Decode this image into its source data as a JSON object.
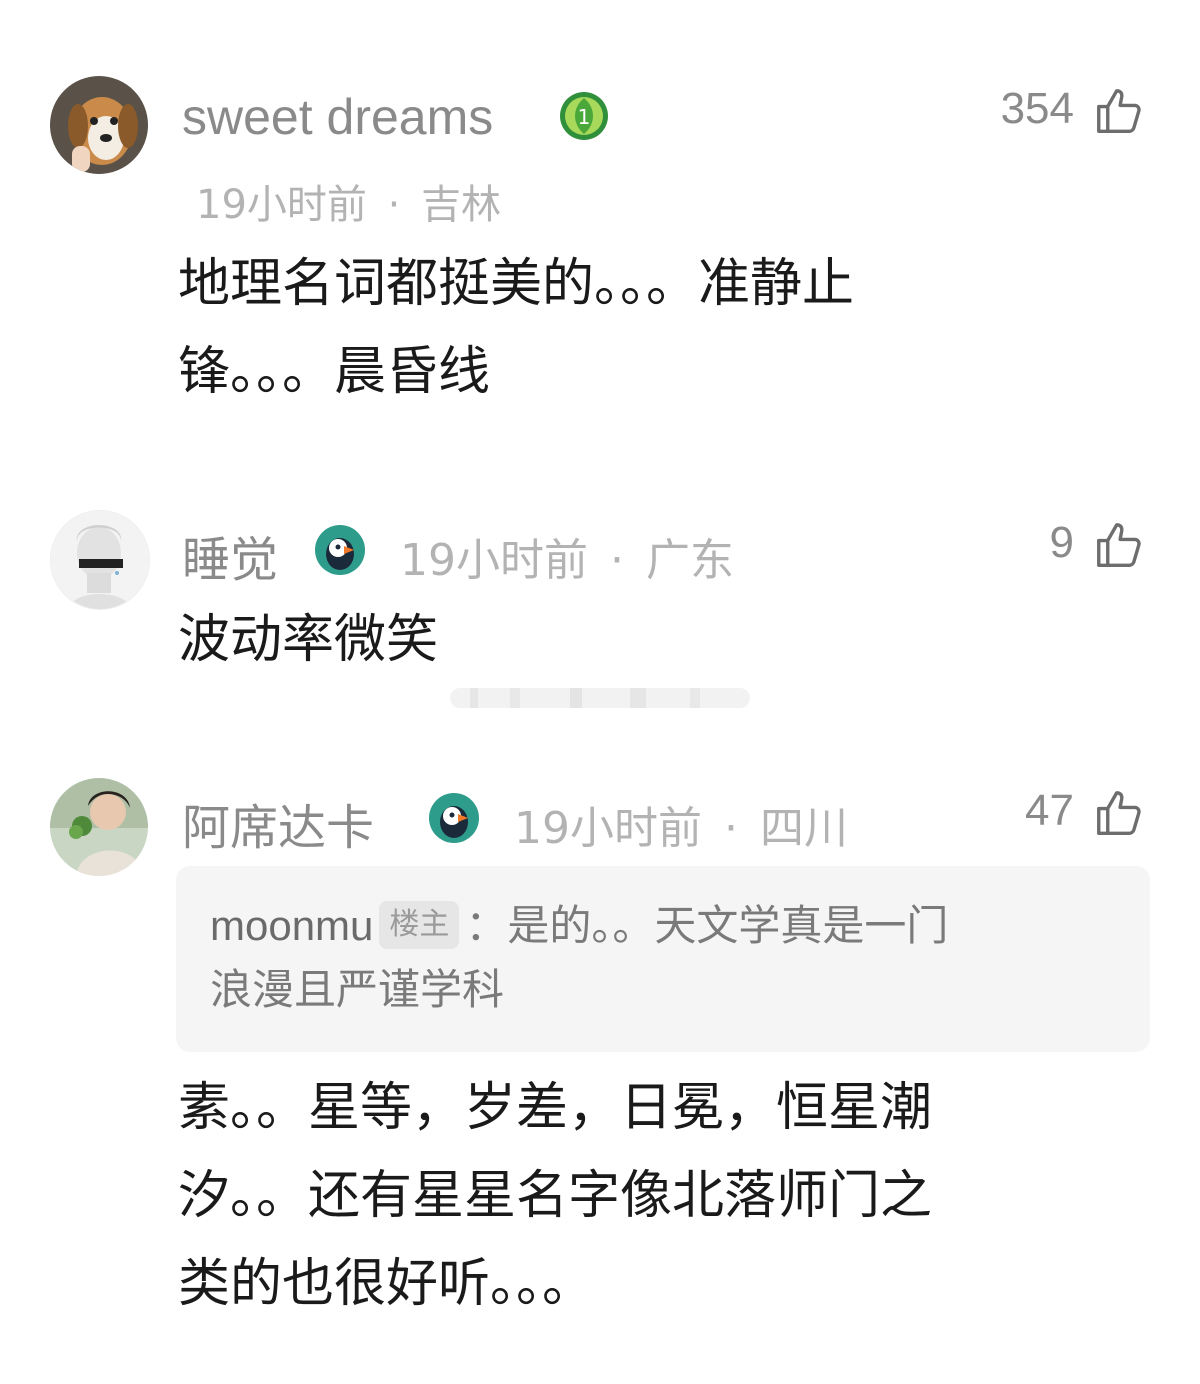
{
  "comments": [
    {
      "username": "sweet dreams",
      "time": "19小时前",
      "location": "吉林",
      "likes": "354",
      "text_lines": [
        "地理名词都挺美的。。。准静止",
        "锋。。。晨昏线"
      ]
    },
    {
      "username": "睡觉",
      "time": "19小时前",
      "location": "广东",
      "likes": "9",
      "text_lines": [
        "波动率微笑"
      ]
    },
    {
      "username": "阿席达卡",
      "time": "19小时前",
      "location": "四川",
      "likes": "47",
      "quote": {
        "user": "moonmu",
        "tag": "楼主",
        "text_line1": "：是的。。天文学真是一门",
        "text_line2": "浪漫且严谨学科"
      },
      "text_lines": [
        "素。。星等，岁差，日冕，恒星潮",
        "汐。。还有星星名字像北落师门之",
        "类的也很好听。。。"
      ]
    }
  ],
  "separator": "·",
  "icons": {
    "like": "thumbs-up-icon",
    "badge_level": "leaf-level-1-badge-icon",
    "badge_puffin": "puffin-badge-icon"
  },
  "colors": {
    "username": "#8a8a8a",
    "meta": "#b3b3b3",
    "body": "#1a1a1a",
    "quote_bg": "#f5f5f5"
  }
}
